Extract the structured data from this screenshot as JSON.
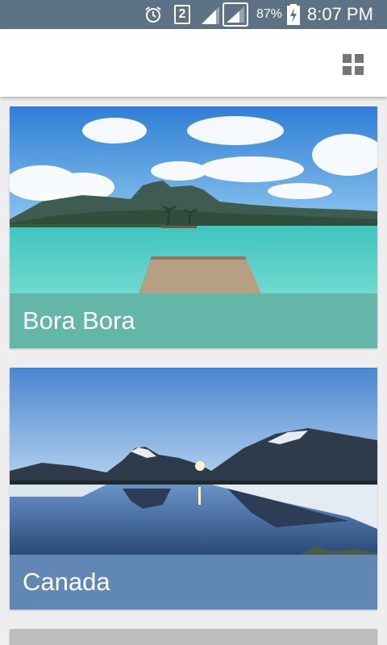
{
  "status_bar": {
    "battery_percent": "87%",
    "time": "8:07 PM",
    "sim_badge": "2",
    "icons": [
      "alarm-icon",
      "sim2-icon",
      "signal-icon",
      "signal-icon",
      "battery-charging-icon"
    ]
  },
  "app_bar": {
    "action_icon": "grid-view-icon"
  },
  "places": [
    {
      "name": "Bora Bora",
      "caption_color": "#64b6a8"
    },
    {
      "name": "Canada",
      "caption_color": "#6188b4"
    },
    {
      "name": "",
      "caption_color": "#bdbdbd"
    }
  ],
  "colors": {
    "status_bar": "#5e7286",
    "app_bar": "#ffffff",
    "background": "#eeeeee"
  }
}
